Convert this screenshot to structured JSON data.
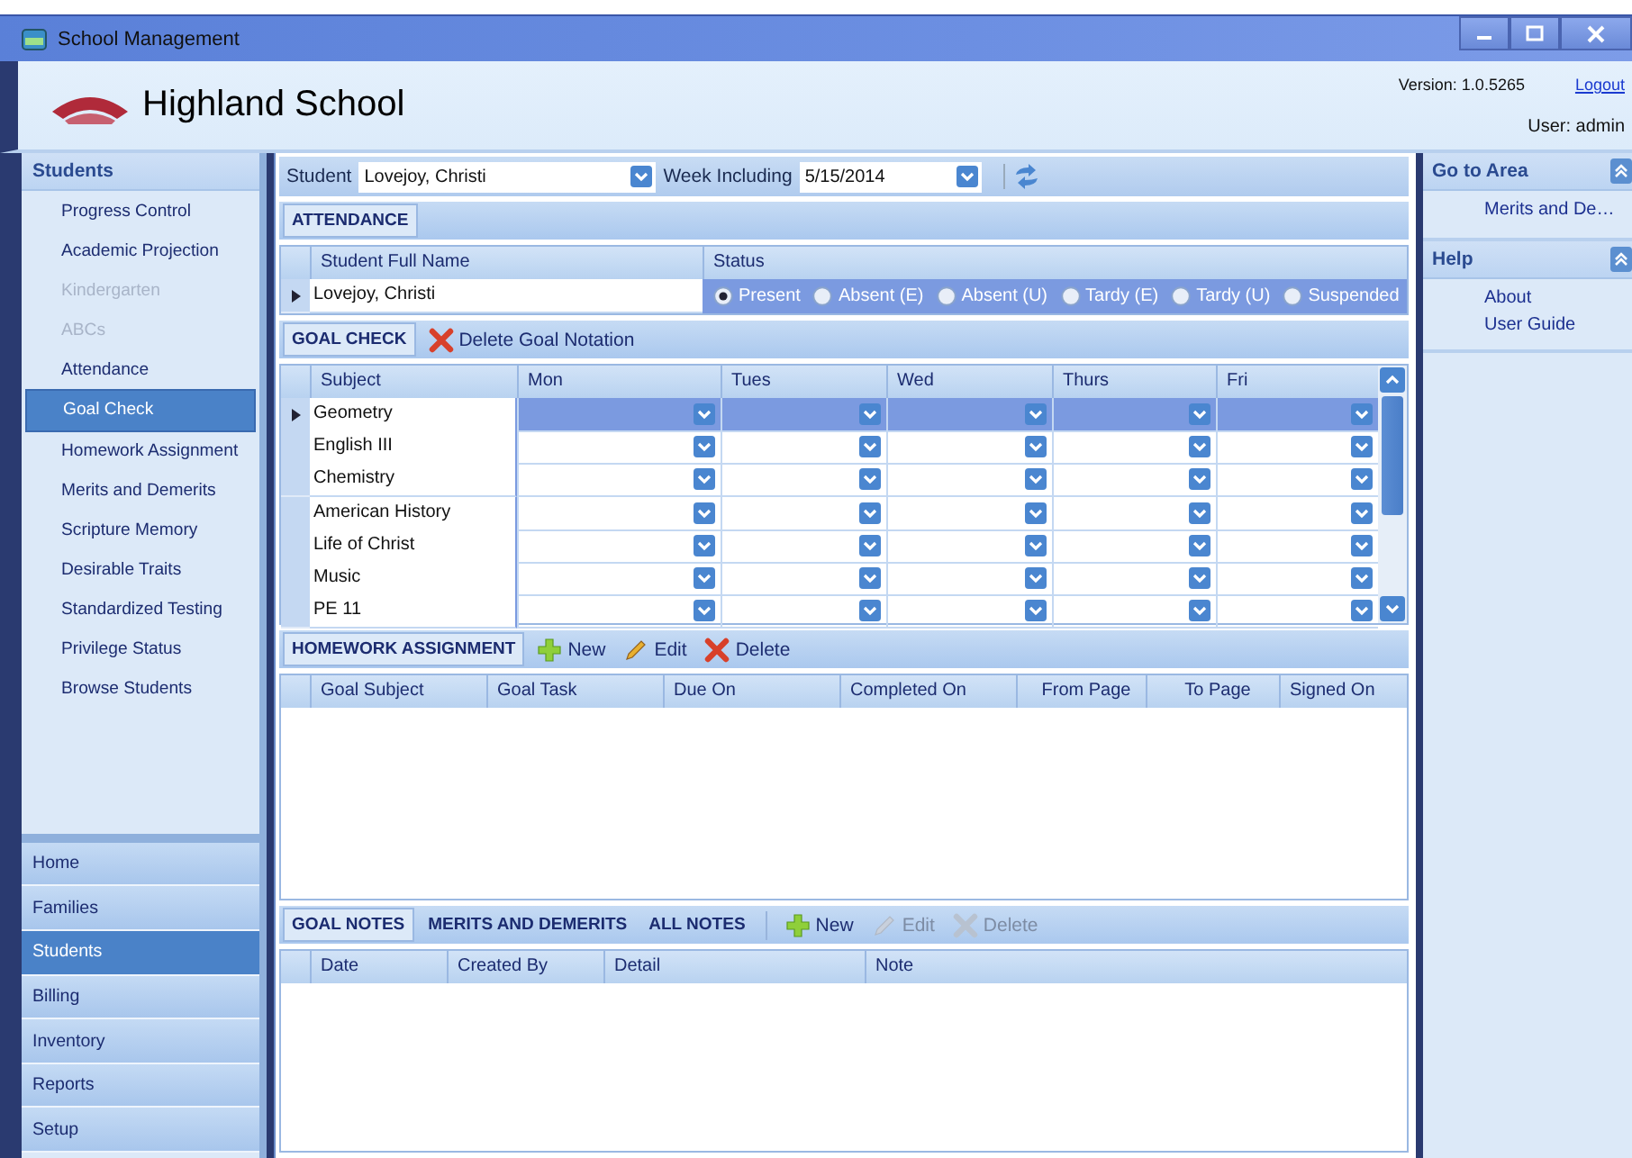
{
  "window": {
    "title": "School Management"
  },
  "header": {
    "school_name": "Highland School",
    "version": "Version: 1.0.5265",
    "logout": "Logout",
    "user": "User: admin"
  },
  "sidebar": {
    "title": "Students",
    "items": [
      {
        "label": "Progress Control",
        "disabled": false,
        "selected": false
      },
      {
        "label": "Academic Projection",
        "disabled": false,
        "selected": false
      },
      {
        "label": "Kindergarten",
        "disabled": true,
        "selected": false
      },
      {
        "label": "ABCs",
        "disabled": true,
        "selected": false
      },
      {
        "label": "Attendance",
        "disabled": false,
        "selected": false
      },
      {
        "label": "Goal Check",
        "disabled": false,
        "selected": true
      },
      {
        "label": "Homework Assignment",
        "disabled": false,
        "selected": false
      },
      {
        "label": "Merits and Demerits",
        "disabled": false,
        "selected": false
      },
      {
        "label": "Scripture Memory",
        "disabled": false,
        "selected": false
      },
      {
        "label": "Desirable Traits",
        "disabled": false,
        "selected": false
      },
      {
        "label": "Standardized Testing",
        "disabled": false,
        "selected": false
      },
      {
        "label": "Privilege Status",
        "disabled": false,
        "selected": false
      },
      {
        "label": "Browse Students",
        "disabled": false,
        "selected": false
      }
    ],
    "nav_buttons": [
      {
        "label": "Home",
        "selected": false
      },
      {
        "label": "Families",
        "selected": false
      },
      {
        "label": "Students",
        "selected": true
      },
      {
        "label": "Billing",
        "selected": false
      },
      {
        "label": "Inventory",
        "selected": false
      },
      {
        "label": "Reports",
        "selected": false
      },
      {
        "label": "Setup",
        "selected": false
      }
    ]
  },
  "toolbar": {
    "student_label": "Student",
    "student_value": "Lovejoy, Christi",
    "week_label": "Week Including",
    "week_value": "5/15/2014"
  },
  "attendance": {
    "tab": "ATTENDANCE",
    "columns": [
      "Student Full Name",
      "Status"
    ],
    "row": {
      "name": "Lovejoy, Christi",
      "statuses": [
        {
          "label": "Present",
          "selected": true
        },
        {
          "label": "Absent (E)",
          "selected": false
        },
        {
          "label": "Absent (U)",
          "selected": false
        },
        {
          "label": "Tardy (E)",
          "selected": false
        },
        {
          "label": "Tardy (U)",
          "selected": false
        },
        {
          "label": "Suspended",
          "selected": false
        }
      ]
    }
  },
  "goal_check": {
    "tab": "GOAL CHECK",
    "action": "Delete Goal Notation",
    "columns": [
      "Subject",
      "Mon",
      "Tues",
      "Wed",
      "Thurs",
      "Fri"
    ],
    "rows": [
      {
        "subject": "Geometry",
        "selected": true
      },
      {
        "subject": "English III",
        "selected": false
      },
      {
        "subject": "Chemistry",
        "selected": false
      },
      {
        "subject": "American History",
        "selected": false
      },
      {
        "subject": "Life of Christ",
        "selected": false
      },
      {
        "subject": "Music",
        "selected": false
      },
      {
        "subject": "PE 11",
        "selected": false
      }
    ]
  },
  "homework": {
    "tab": "HOMEWORK ASSIGNMENT",
    "actions": [
      {
        "kind": "new",
        "label": "New",
        "disabled": false
      },
      {
        "kind": "edit",
        "label": "Edit",
        "disabled": false
      },
      {
        "kind": "delete",
        "label": "Delete",
        "disabled": false
      }
    ],
    "columns": [
      "Goal Subject",
      "Goal Task",
      "Due On",
      "Completed On",
      "From Page",
      "To Page",
      "Signed On"
    ]
  },
  "notes": {
    "tabs": [
      {
        "label": "GOAL NOTES",
        "selected": true
      },
      {
        "label": "MERITS AND DEMERITS",
        "selected": false
      },
      {
        "label": "ALL NOTES",
        "selected": false
      }
    ],
    "actions": [
      {
        "kind": "new",
        "label": "New",
        "disabled": false
      },
      {
        "kind": "edit",
        "label": "Edit",
        "disabled": true
      },
      {
        "kind": "delete",
        "label": "Delete",
        "disabled": true
      }
    ],
    "columns": [
      "Date",
      "Created By",
      "Detail",
      "Note"
    ]
  },
  "right_panel": [
    {
      "title": "Go to Area",
      "items": [
        "Merits and De…"
      ]
    },
    {
      "title": "Help",
      "items": [
        "About",
        "User Guide"
      ]
    }
  ]
}
